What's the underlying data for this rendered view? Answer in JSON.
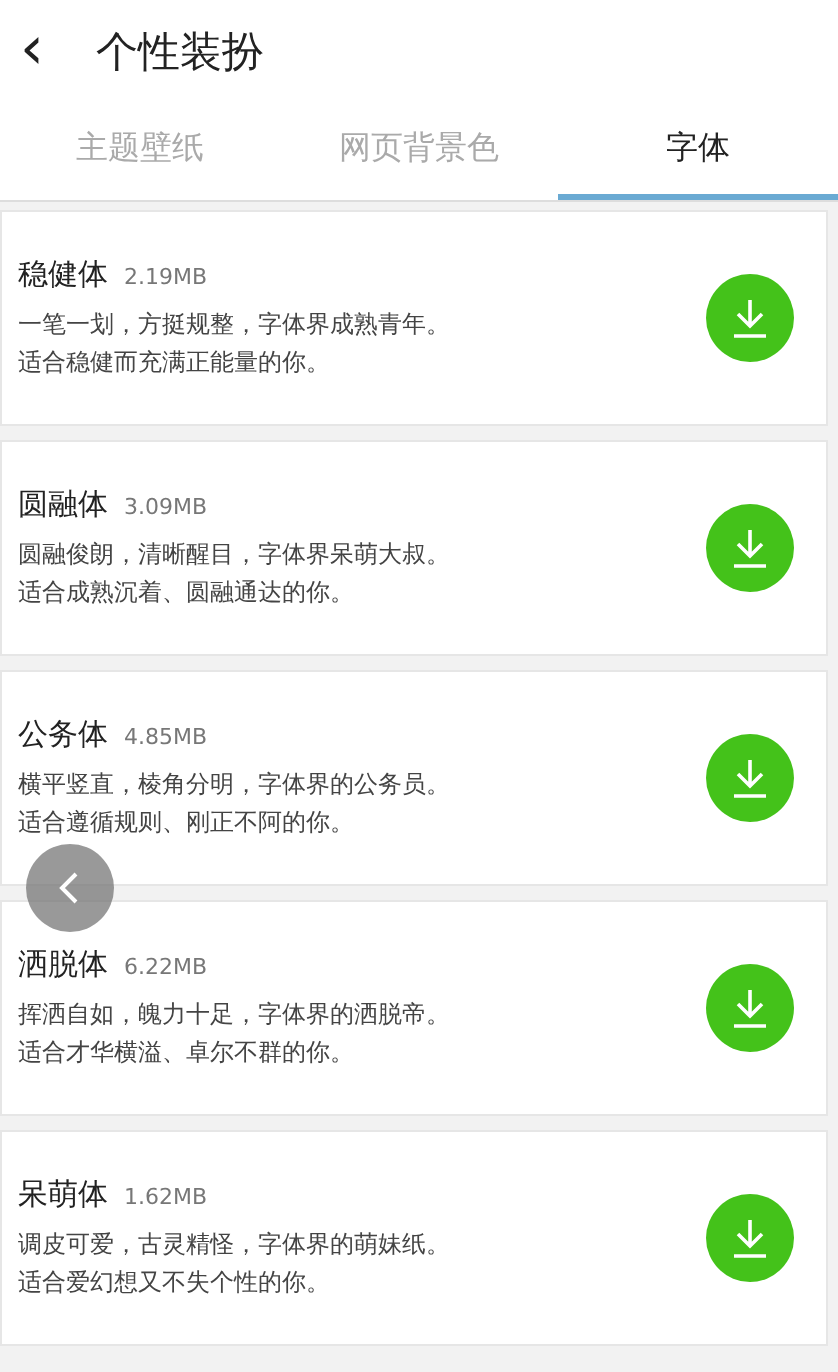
{
  "header": {
    "back": "‹",
    "title": "个性装扮"
  },
  "tabs": [
    {
      "label": "主题壁纸",
      "selected": false
    },
    {
      "label": "网页背景色",
      "selected": false
    },
    {
      "label": "字体",
      "selected": true
    }
  ],
  "fonts": [
    {
      "name": "稳健体",
      "size": "2.19MB",
      "lines": [
        "一笔一划，方挺规整，字体界成熟青年。",
        "适合稳健而充满正能量的你。"
      ]
    },
    {
      "name": "圆融体",
      "size": "3.09MB",
      "lines": [
        "圆融俊朗，清晰醒目，字体界呆萌大叔。",
        "适合成熟沉着、圆融通达的你。"
      ]
    },
    {
      "name": "公务体",
      "size": "4.85MB",
      "lines": [
        "横平竖直，棱角分明，字体界的公务员。",
        "适合遵循规则、刚正不阿的你。"
      ]
    },
    {
      "name": "洒脱体",
      "size": "6.22MB",
      "lines": [
        "挥洒自如，魄力十足，字体界的洒脱帝。",
        "适合才华横溢、卓尔不群的你。"
      ]
    },
    {
      "name": "呆萌体",
      "size": "1.62MB",
      "lines": [
        "调皮可爱，古灵精怪，字体界的萌妹纸。",
        "适合爱幻想又不失个性的你。"
      ]
    }
  ]
}
